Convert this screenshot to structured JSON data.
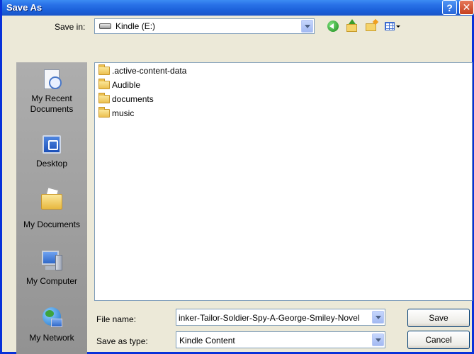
{
  "window": {
    "title": "Save As",
    "help_label": "?",
    "close_label": "✕"
  },
  "toolbar": {
    "save_in_label": "Save in:",
    "save_in_value": "Kindle (E:)"
  },
  "places": [
    {
      "label_line1": "My Recent",
      "label_line2": "Documents",
      "icon": "recent-documents-icon"
    },
    {
      "label_line1": "Desktop",
      "label_line2": "",
      "icon": "desktop-icon"
    },
    {
      "label_line1": "My Documents",
      "label_line2": "",
      "icon": "my-documents-icon"
    },
    {
      "label_line1": "My Computer",
      "label_line2": "",
      "icon": "my-computer-icon"
    },
    {
      "label_line1": "My Network",
      "label_line2": "",
      "icon": "my-network-icon"
    }
  ],
  "files": [
    {
      "name": ".active-content-data"
    },
    {
      "name": "Audible"
    },
    {
      "name": "documents"
    },
    {
      "name": "music"
    }
  ],
  "form": {
    "file_name_label": "File name:",
    "file_name_value": "inker-Tailor-Soldier-Spy-A-George-Smiley-Novel",
    "save_as_type_label": "Save as type:",
    "save_as_type_value": "Kindle Content"
  },
  "buttons": {
    "save": "Save",
    "cancel": "Cancel"
  }
}
